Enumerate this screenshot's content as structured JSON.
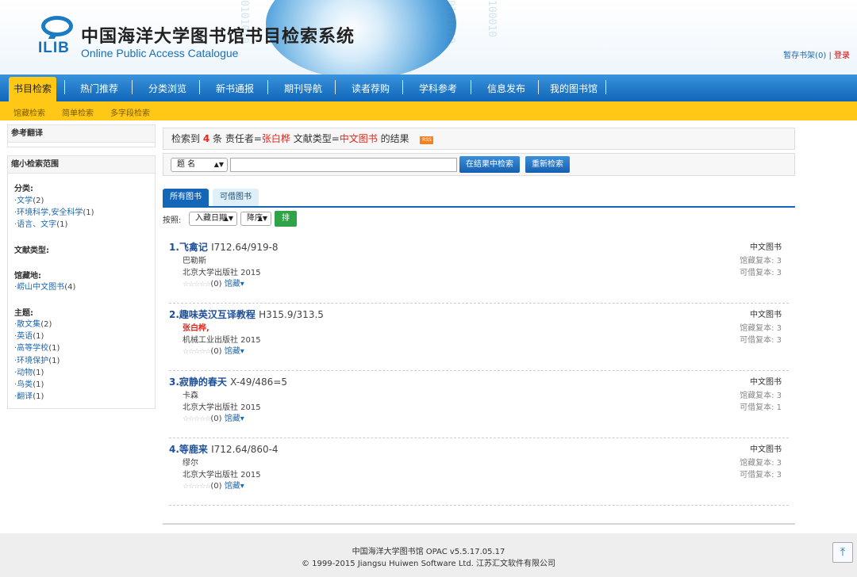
{
  "header": {
    "logo_text": "ILIB",
    "title": "中国海洋大学图书馆书目检索系统",
    "subtitle": "Online Public Access Catalogue",
    "cart": "暂存书架(0)",
    "separator": "|",
    "login": "登录"
  },
  "nav": [
    "书目检索",
    "热门推荐",
    "分类浏览",
    "新书通报",
    "期刊导航",
    "读者荐购",
    "学科参考",
    "信息发布",
    "我的图书馆"
  ],
  "subnav": [
    "馆藏检索",
    "简单检索",
    "多字段检索"
  ],
  "sidebar": {
    "reference_title": "参考翻译",
    "narrow_title": "缩小检索范围",
    "class_label": "分类:",
    "class_items": [
      {
        "label": "·文学",
        "count": "(2)"
      },
      {
        "label": "·环境科学,安全科学",
        "count": "(1)"
      },
      {
        "label": "·语言、文字",
        "count": "(1)"
      }
    ],
    "doctype_label": "文献类型:",
    "location_label": "馆藏地:",
    "location_items": [
      {
        "label": "·崂山中文图书",
        "count": "(4)"
      }
    ],
    "subject_label": "主题:",
    "subject_items": [
      {
        "label": "·散文集",
        "count": "(2)"
      },
      {
        "label": "·英语",
        "count": "(1)"
      },
      {
        "label": "·高等学校",
        "count": "(1)"
      },
      {
        "label": "·环境保护",
        "count": "(1)"
      },
      {
        "label": "·动物",
        "count": "(1)"
      },
      {
        "label": "·鸟类",
        "count": "(1)"
      },
      {
        "label": "·翻译",
        "count": "(1)"
      }
    ]
  },
  "result_summary": {
    "prefix": "检索到",
    "count": "4",
    "mid": "条 责任者=",
    "author": "张白桦",
    "mid2": " 文献类型=",
    "doctype": "中文图书",
    "suffix": " 的结果",
    "rss": "RSS"
  },
  "search": {
    "field_select": "题 名",
    "query": "",
    "search_within_button": "在结果中检索",
    "new_search_button": "重新检索"
  },
  "tabs": [
    "所有图书",
    "可借图书"
  ],
  "sort": {
    "label": "按照:",
    "field": "入藏日期",
    "order": "降序",
    "button": "排列"
  },
  "books": [
    {
      "num": "1.",
      "title": "飞禽记",
      "call": "I712.64/919-8",
      "author": "巴勒斯",
      "author_highlight": false,
      "publisher": "北京大学出版社 2015",
      "rating": "(0)",
      "holdings": "馆藏",
      "type": "中文图书",
      "total_copies": "馆藏复本: 3",
      "available": "可借复本: 3"
    },
    {
      "num": "2.",
      "title": "趣味英汉互译教程",
      "call": "H315.9/313.5",
      "author": "张白桦,",
      "author_highlight": true,
      "publisher": "机械工业出版社 2015",
      "rating": "(0)",
      "holdings": "馆藏",
      "type": "中文图书",
      "total_copies": "馆藏复本: 3",
      "available": "可借复本: 3"
    },
    {
      "num": "3.",
      "title": "寂静的春天",
      "call": "X-49/486=5",
      "author": "卡森",
      "author_highlight": false,
      "publisher": "北京大学出版社 2015",
      "rating": "(0)",
      "holdings": "馆藏",
      "type": "中文图书",
      "total_copies": "馆藏复本: 3",
      "available": "可借复本: 1"
    },
    {
      "num": "4.",
      "title": "等鹿来",
      "call": "I712.64/860-4",
      "author": "缪尔",
      "author_highlight": false,
      "publisher": "北京大学出版社 2015",
      "rating": "(0)",
      "holdings": "馆藏",
      "type": "中文图书",
      "total_copies": "馆藏复本: 3",
      "available": "可借复本: 3"
    }
  ],
  "footer": {
    "line1": "中国海洋大学图书馆 OPAC v5.5.17.05.17",
    "line2": "© 1999-2015 Jiangsu Huiwen Software Ltd. 江苏汇文软件有限公司"
  },
  "colors": {
    "nav_blue": "#1066b8",
    "highlight_yellow": "#ffc817",
    "accent_red": "#e3251b",
    "link_blue": "#1d68b0"
  }
}
